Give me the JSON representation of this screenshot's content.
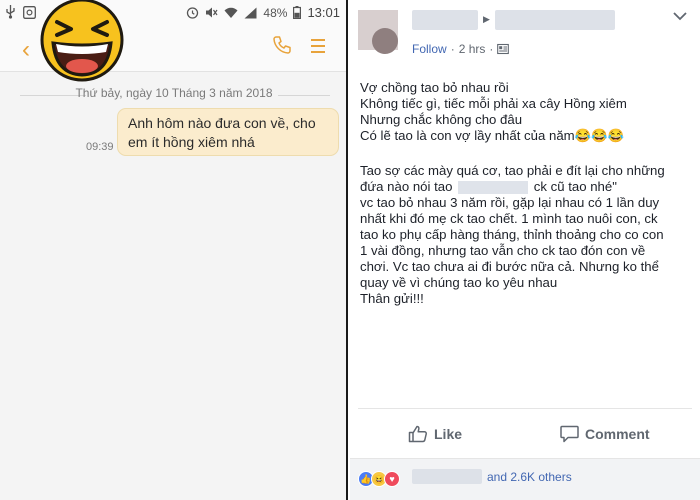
{
  "sms": {
    "status_bar": {
      "battery_percent": "48%",
      "time": "13:01"
    },
    "date_separator": "Thứ bảy, ngày 10 Tháng 3 năm 2018",
    "message": {
      "line1": "Anh hôm nào đưa con về, cho",
      "line2": "em ít hồng xiêm nhá",
      "time": "09:39"
    },
    "accent_color": "#e8a33b",
    "bubble_color": "#fbeccd"
  },
  "facebook": {
    "header": {
      "follow_label": "Follow",
      "separator": "·",
      "time": "2 hrs",
      "separator2": "·"
    },
    "post_lines_p1": [
      "Vợ chồng tao bỏ nhau rồi",
      "Không tiếc gì, tiếc mỗi phải xa cây Hồng xiêm",
      "Nhưng chắc không cho đâu",
      "Có lẽ tao là con vợ lầy nhất của năm😂😂😂"
    ],
    "post_lines_p2": {
      "line1": "Tao sợ các mày quá cơ, tao phải e đít lại cho những",
      "line2_a": "đứa nào nói tao",
      "line2_b": "ck cũ tao nhé\"",
      "line3": "vc tao bỏ nhau 3 năm rồi, gặp lại nhau có 1 lần duy",
      "line4": "nhất khi đó mẹ ck tao chết. 1 mình tao nuôi con, ck",
      "line5": "tao ko phụ cấp hàng tháng, thỉnh thoảng cho co con",
      "line6": "1 vài đồng, nhưng tao vẫn cho ck tao đón con về",
      "line7": "chơi. Vc tao chưa ai đi bước nữa cả. Nhưng ko thể",
      "line8": "quay về vì chúng tao ko yêu nhau",
      "line9": "Thân gửi!!!"
    },
    "like_label": "Like",
    "comment_label": "Comment",
    "others_label": "and 2.6K others",
    "link_color": "#4267b2"
  }
}
